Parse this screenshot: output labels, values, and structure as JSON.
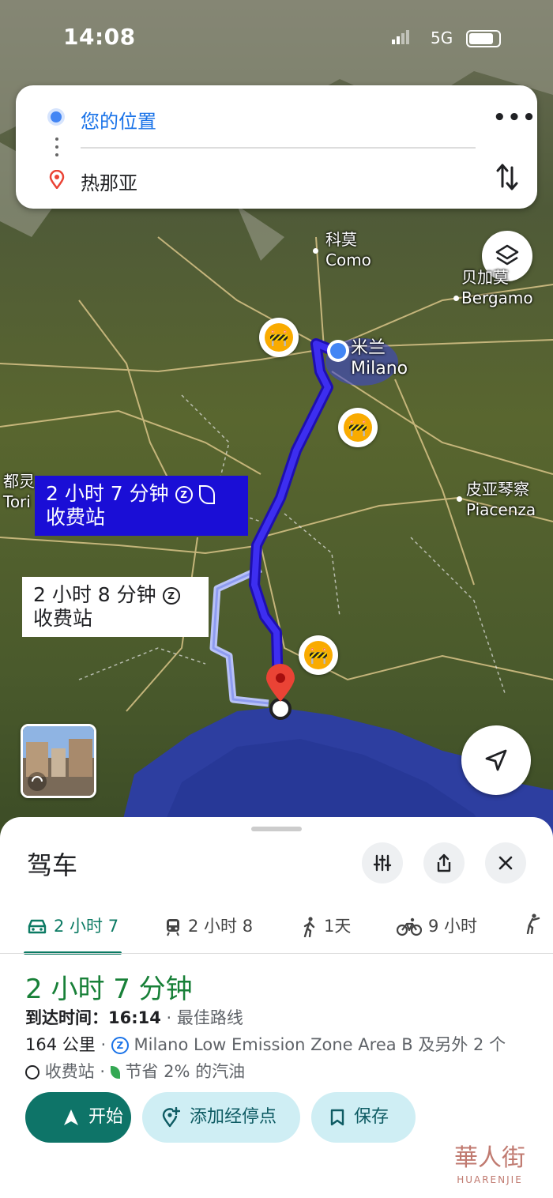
{
  "status": {
    "time": "14:08",
    "network": "5G"
  },
  "search": {
    "origin": "您的位置",
    "destination": "热那亚"
  },
  "cities": [
    {
      "cn": "科莫",
      "en": "Como"
    },
    {
      "cn": "贝加莫",
      "en": "Bergamo"
    },
    {
      "cn": "米兰",
      "en": "Milano"
    },
    {
      "cn": "都灵",
      "en": "Tori"
    },
    {
      "cn": "皮亚琴察",
      "en": "Piacenza"
    }
  ],
  "route_labels": {
    "primary_time": "2 小时 7 分钟",
    "primary_sub": "收费站",
    "alt_time": "2 小时 8 分钟",
    "alt_sub": "收费站",
    "z_badge": "Z"
  },
  "colors": {
    "route_primary": "#2a10d8",
    "route_alt": "#a9b4f5",
    "accent": "#0e7468",
    "duration": "#188038"
  },
  "sheet": {
    "title": "驾车",
    "tabs": [
      {
        "icon": "car-icon",
        "label": "2 小时 7"
      },
      {
        "icon": "train-icon",
        "label": "2 小时 8"
      },
      {
        "icon": "walk-icon",
        "label": "1天"
      },
      {
        "icon": "bike-icon",
        "label": "9 小时"
      }
    ],
    "duration": "2 小时 7 分钟",
    "arrival_label": "到达时间：",
    "arrival_time": "16:14",
    "best_route": "最佳路线",
    "distance": "164 公里",
    "zone": "Milano Low Emission Zone Area B 及另外 2 个",
    "toll": "收费站",
    "fuel": "节省 2% 的汽油",
    "sep": "·",
    "actions": {
      "start": "开始",
      "add_stop": "添加经停点",
      "save": "保存"
    }
  },
  "watermark": {
    "cn": "華人街",
    "en": "HUARENJIE"
  }
}
